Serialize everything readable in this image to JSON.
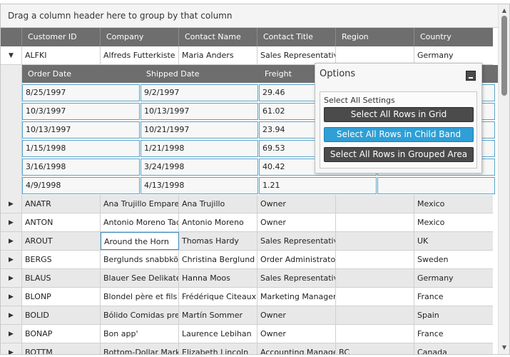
{
  "group_area": {
    "text": "Drag a column header here to group by that column"
  },
  "columns": [
    "Customer ID",
    "Company",
    "Contact Name",
    "Contact Title",
    "Region",
    "Country"
  ],
  "expanded_row": {
    "expander": "▼",
    "cells": [
      "ALFKI",
      "Alfreds Futterkiste",
      "Maria Anders",
      "Sales Representative",
      "",
      "Germany"
    ]
  },
  "child_band": {
    "columns": [
      "Order Date",
      "Shipped Date",
      "Freight",
      ""
    ],
    "rows": [
      [
        "8/25/1997",
        "9/2/1997",
        "29.46",
        ""
      ],
      [
        "10/3/1997",
        "10/13/1997",
        "61.02",
        ""
      ],
      [
        "10/13/1997",
        "10/21/1997",
        "23.94",
        ""
      ],
      [
        "1/15/1998",
        "1/21/1998",
        "69.53",
        ""
      ],
      [
        "3/16/1998",
        "3/24/1998",
        "40.42",
        ""
      ],
      [
        "4/9/1998",
        "4/13/1998",
        "1.21",
        ""
      ]
    ]
  },
  "rows": [
    {
      "expander": "▶",
      "cells": [
        "ANATR",
        "Ana Trujillo Emparedados",
        "Ana Trujillo",
        "Owner",
        "",
        "Mexico"
      ]
    },
    {
      "expander": "▶",
      "cells": [
        "ANTON",
        "Antonio Moreno Taquería",
        "Antonio Moreno",
        "Owner",
        "",
        "Mexico"
      ]
    },
    {
      "expander": "▶",
      "cells": [
        "AROUT",
        "Around the Horn",
        "Thomas Hardy",
        "Sales Representative",
        "",
        "UK"
      ]
    },
    {
      "expander": "▶",
      "cells": [
        "BERGS",
        "Berglunds snabbköp",
        "Christina Berglund",
        "Order Administrator",
        "",
        "Sweden"
      ]
    },
    {
      "expander": "▶",
      "cells": [
        "BLAUS",
        "Blauer See Delikatessen",
        "Hanna Moos",
        "Sales Representative",
        "",
        "Germany"
      ]
    },
    {
      "expander": "▶",
      "cells": [
        "BLONP",
        "Blondel père et fils",
        "Frédérique Citeaux",
        "Marketing Manager",
        "",
        "France"
      ]
    },
    {
      "expander": "▶",
      "cells": [
        "BOLID",
        "Bólido Comidas preparadas",
        "Martín Sommer",
        "Owner",
        "",
        "Spain"
      ]
    },
    {
      "expander": "▶",
      "cells": [
        "BONAP",
        "Bon app'",
        "Laurence Lebihan",
        "Owner",
        "",
        "France"
      ]
    },
    {
      "expander": "▶",
      "cells": [
        "BOTTM",
        "Bottom-Dollar Markets",
        "Elizabeth Lincoln",
        "Accounting Manager",
        "BC",
        "Canada"
      ]
    }
  ],
  "options_panel": {
    "title": "Options",
    "group_label": "Select All Settings",
    "buttons": [
      "Select All Rows in Grid",
      "Select All Rows in Child Band",
      "Select All Rows in Grouped Area"
    ],
    "active_button_index": 1
  },
  "scrollbar": {
    "up_arrow": "▲",
    "down_arrow": "▼"
  },
  "colors": {
    "header_bg": "#6e6e6e",
    "row_alt_bg": "#e8e8e8",
    "accent_blue": "#2f9fd6",
    "button_dark": "#4b4b4b"
  }
}
